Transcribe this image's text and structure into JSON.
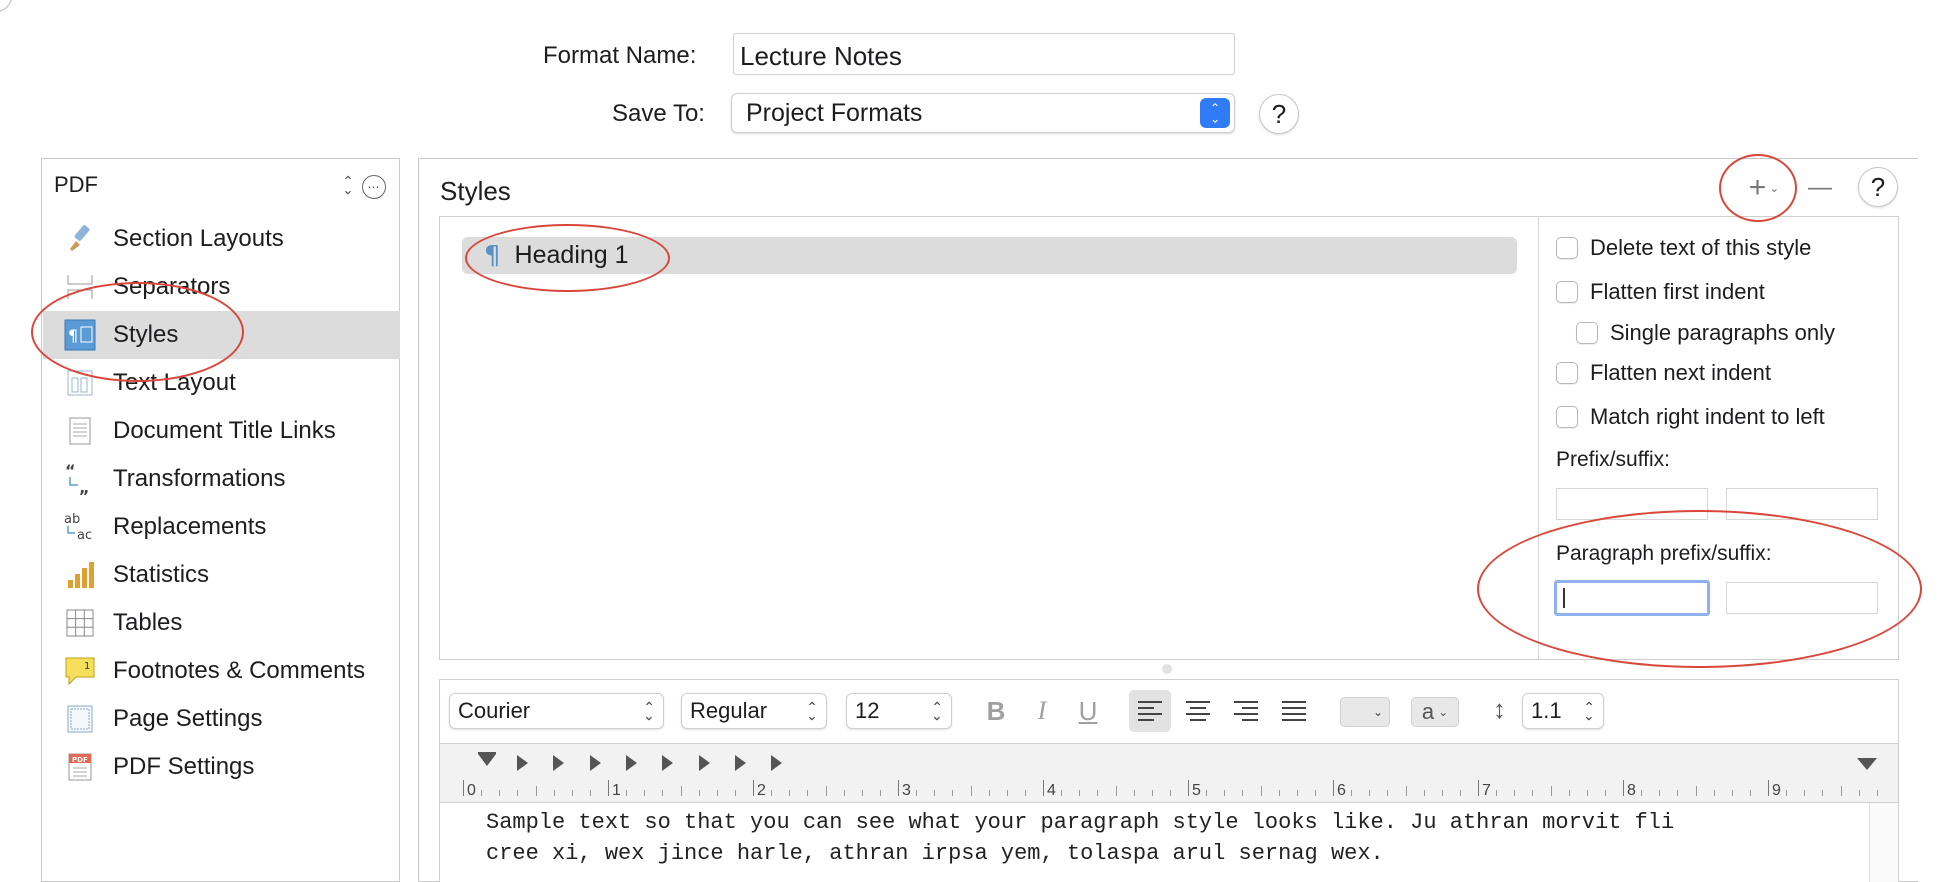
{
  "header": {
    "format_name_label": "Format Name:",
    "format_name_value": "Lecture Notes",
    "save_to_label": "Save To:",
    "save_to_value": "Project Formats",
    "help_label": "?"
  },
  "sidebar": {
    "selector_value": "PDF",
    "items": [
      {
        "label": "Section Layouts",
        "icon": "paintbrush-icon"
      },
      {
        "label": "Separators",
        "icon": "separator-icon"
      },
      {
        "label": "Styles",
        "icon": "styles-icon",
        "selected": true
      },
      {
        "label": "Text Layout",
        "icon": "text-layout-icon"
      },
      {
        "label": "Document Title Links",
        "icon": "document-icon"
      },
      {
        "label": "Transformations",
        "icon": "quotes-icon"
      },
      {
        "label": "Replacements",
        "icon": "ab-ac-icon"
      },
      {
        "label": "Statistics",
        "icon": "bar-chart-icon"
      },
      {
        "label": "Tables",
        "icon": "table-icon"
      },
      {
        "label": "Footnotes & Comments",
        "icon": "footnote-icon"
      },
      {
        "label": "Page Settings",
        "icon": "page-icon"
      },
      {
        "label": "PDF Settings",
        "icon": "pdf-icon"
      }
    ]
  },
  "styles_panel": {
    "title": "Styles",
    "add_label": "+",
    "remove_label": "—",
    "help_label": "?",
    "style_list": [
      {
        "label": "Heading 1",
        "icon": "pilcrow-icon"
      }
    ],
    "options": {
      "delete_text": "Delete text of this style",
      "flatten_first": "Flatten first indent",
      "single_paragraphs": "Single paragraphs only",
      "flatten_next": "Flatten next indent",
      "match_right": "Match right indent to left",
      "prefix_suffix_label": "Prefix/suffix:",
      "para_prefix_suffix_label": "Paragraph prefix/suffix:"
    }
  },
  "format_bar": {
    "font": "Courier",
    "typeface": "Regular",
    "size": "12",
    "bold": "B",
    "italic": "I",
    "underline": "U",
    "case_value": "a",
    "line_spacing": "1.1"
  },
  "ruler": {
    "ticks": [
      "0",
      "1",
      "2",
      "3",
      "4",
      "5",
      "6",
      "7",
      "8",
      "9"
    ]
  },
  "preview": {
    "line1": "Sample text so that you can see what your paragraph style looks like. Ju athran morvit fli",
    "line2": "cree xi, wex jince harle, athran irpsa yem, tolaspa arul sernag wex."
  },
  "annotation_color": "#d9473b",
  "accent_color": "#2f7cf6"
}
